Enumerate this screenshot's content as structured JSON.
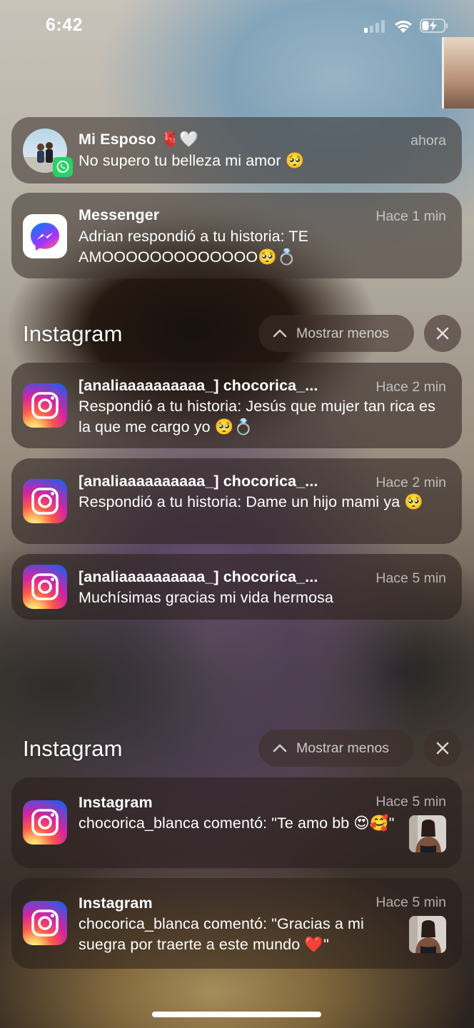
{
  "status_bar": {
    "time": "6:42",
    "signal_bars_active": 1,
    "signal_bars_total": 4,
    "battery_charging": true
  },
  "colors": {
    "instagram_gradient": [
      "#f9ce34",
      "#ee2a7b",
      "#6228d7"
    ],
    "messenger_gradient": [
      "#0a7cff",
      "#a033ff",
      "#ff5c87"
    ],
    "whatsapp_green": "#25d366"
  },
  "notifications_top": [
    {
      "app": "WhatsApp",
      "icon": "avatar-with-whatsapp-badge-icon",
      "title": "Mi Esposo 🫀🤍",
      "time": "ahora",
      "body": "No supero tu belleza mi amor 🥺"
    },
    {
      "app": "Messenger",
      "icon": "messenger-icon",
      "title": "Messenger",
      "time": "Hace 1 min",
      "body": "Adrian respondió a tu historia: TE AMOOOOOOOOOOOOO🥺💍"
    }
  ],
  "groups": [
    {
      "title": "Instagram",
      "show_less_label": "Mostrar menos",
      "notifications": [
        {
          "icon": "instagram-icon",
          "title": "[analiaaaaaaaaaa_] chocorica_...",
          "time": "Hace 2 min",
          "body": "Respondió a tu historia: Jesús que mujer tan rica es la que me cargo  yo 🥺💍"
        },
        {
          "icon": "instagram-icon",
          "title": "[analiaaaaaaaaaa_] chocorica_...",
          "time": "Hace 2 min",
          "body": "Respondió a tu historia: Dame un hijo mami ya 🥺"
        },
        {
          "icon": "instagram-icon",
          "title": "[analiaaaaaaaaaa_] chocorica_...",
          "time": "Hace 5 min",
          "body": "Muchísimas gracias mi vida hermosa"
        }
      ]
    },
    {
      "title": "Instagram",
      "show_less_label": "Mostrar menos",
      "notifications": [
        {
          "icon": "instagram-icon",
          "title": "Instagram",
          "time": "Hace 5 min",
          "body": "chocorica_blanca comentó: \"Te amo bb 😍🥰\""
        },
        {
          "icon": "instagram-icon",
          "title": "Instagram",
          "time": "Hace 5 min",
          "body": "chocorica_blanca comentó: \"Gracias a mi suegra por traerte a este mundo ❤️\""
        }
      ]
    }
  ]
}
